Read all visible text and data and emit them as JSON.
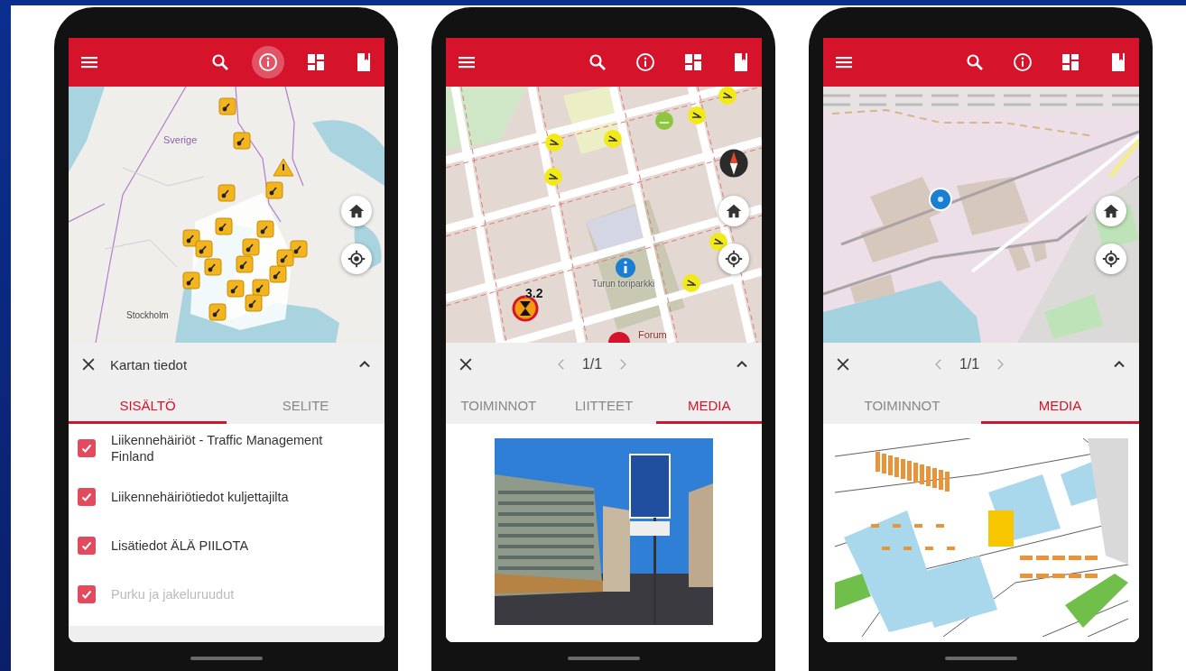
{
  "phones": [
    {
      "toolbar": [
        {
          "kind": "menu",
          "selected": false
        },
        {
          "kind": "search",
          "selected": false
        },
        {
          "kind": "info",
          "selected": true
        },
        {
          "kind": "dashboard",
          "selected": false
        },
        {
          "kind": "book",
          "selected": false
        }
      ],
      "map": {
        "kind": "region",
        "labels": [
          "Sverige",
          "Stockholm"
        ],
        "buttons": [
          {
            "kind": "home"
          },
          {
            "kind": "locate"
          }
        ]
      },
      "sheet": {
        "kind": "layers",
        "title": "Kartan tiedot",
        "tabs": [
          {
            "label": "SISÄLTÖ",
            "selected": true
          },
          {
            "label": "SELITE",
            "selected": false
          }
        ],
        "layers": [
          {
            "label": "Liikennehäiriöt - Traffic Management Finland",
            "checked": true,
            "disabled": false
          },
          {
            "label": "Liikennehäiriötiedot kuljettajilta",
            "checked": true,
            "disabled": false
          },
          {
            "label": "Lisätiedot ÄLÄ PIILOTA",
            "checked": true,
            "disabled": false
          },
          {
            "label": "Purku ja jakeluruudut",
            "checked": true,
            "disabled": true
          }
        ]
      }
    },
    {
      "toolbar": [
        {
          "kind": "menu",
          "selected": false
        },
        {
          "kind": "search",
          "selected": false
        },
        {
          "kind": "info",
          "selected": false
        },
        {
          "kind": "dashboard",
          "selected": false
        },
        {
          "kind": "book",
          "selected": false
        }
      ],
      "map": {
        "kind": "city",
        "labels": [
          "Turun toriparkki",
          "3.2",
          "Forum"
        ],
        "buttons": [
          {
            "kind": "compass"
          },
          {
            "kind": "home"
          },
          {
            "kind": "locate"
          }
        ]
      },
      "sheet": {
        "kind": "feature",
        "pager": "1/1",
        "tabs": [
          {
            "label": "TOIMINNOT",
            "selected": false
          },
          {
            "label": "LIITTEET",
            "selected": false
          },
          {
            "label": "MEDIA",
            "selected": true
          }
        ],
        "media": {
          "kind": "photo"
        }
      }
    },
    {
      "toolbar": [
        {
          "kind": "menu",
          "selected": false
        },
        {
          "kind": "search",
          "selected": false
        },
        {
          "kind": "info",
          "selected": false
        },
        {
          "kind": "dashboard",
          "selected": false
        },
        {
          "kind": "book",
          "selected": false
        }
      ],
      "map": {
        "kind": "port",
        "buttons": [
          {
            "kind": "home"
          },
          {
            "kind": "locate"
          }
        ]
      },
      "sheet": {
        "kind": "feature",
        "pager": "1/1",
        "tabs": [
          {
            "label": "TOIMINNOT",
            "selected": false
          },
          {
            "label": "MEDIA",
            "selected": true
          }
        ],
        "media": {
          "kind": "plan"
        }
      }
    }
  ]
}
